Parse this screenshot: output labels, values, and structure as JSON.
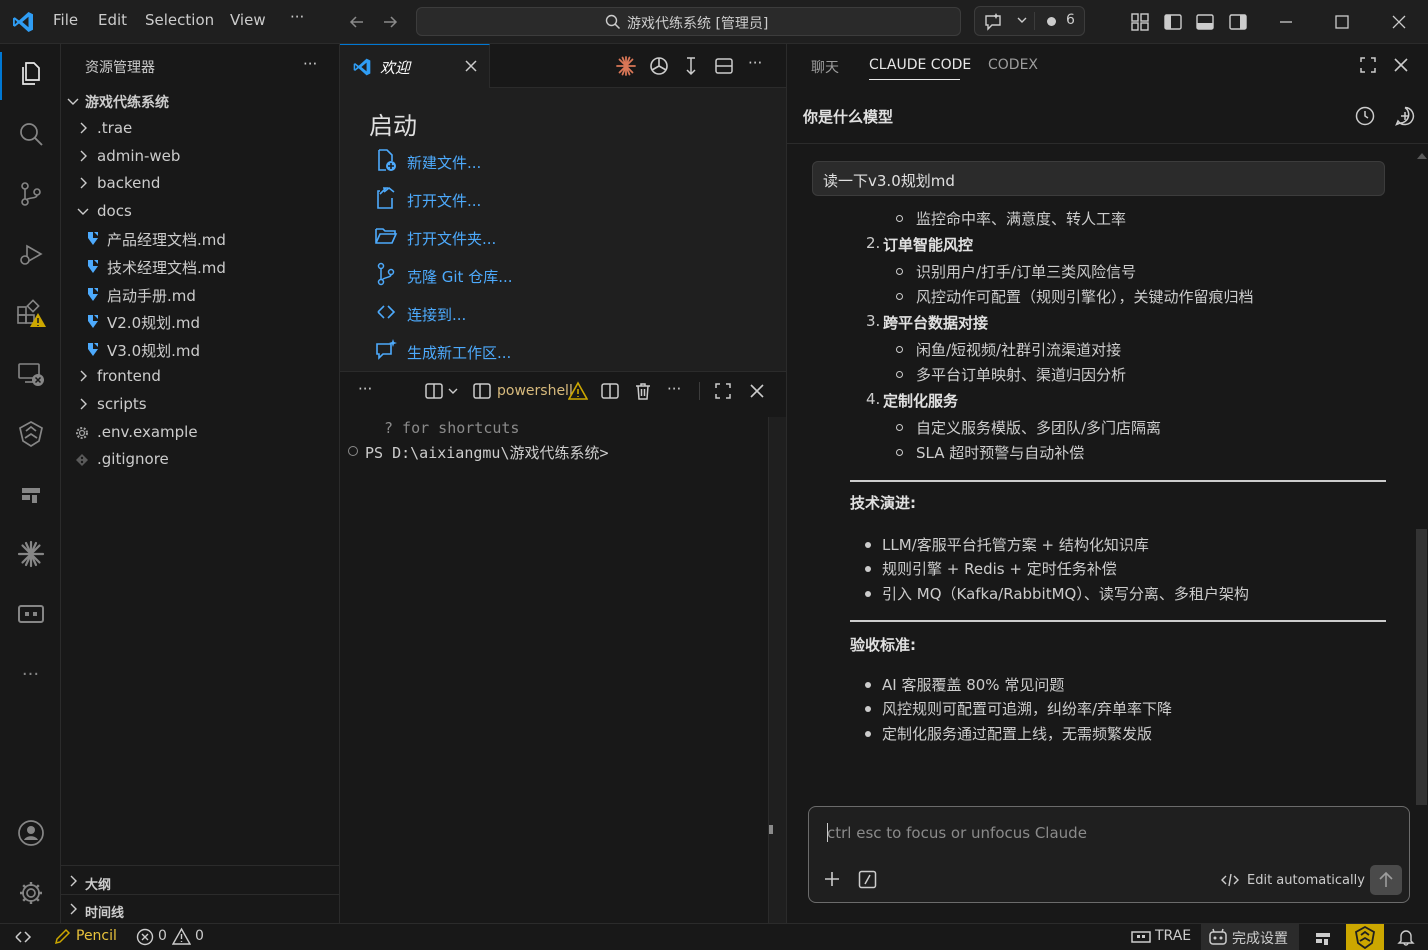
{
  "menu": {
    "file": "File",
    "edit": "Edit",
    "selection": "Selection",
    "view": "View",
    "more": "···"
  },
  "search": {
    "text": "游戏代练系统 [管理员]"
  },
  "chat_pill": {
    "count": "6"
  },
  "sidebar": {
    "title": "资源管理器",
    "more": "···",
    "root": "游戏代练系统",
    "items": [
      {
        "label": ".trae",
        "kind": "folder"
      },
      {
        "label": "admin-web",
        "kind": "folder"
      },
      {
        "label": "backend",
        "kind": "folder"
      },
      {
        "label": "docs",
        "kind": "folder-open"
      },
      {
        "label": "产品经理文档.md",
        "kind": "md"
      },
      {
        "label": "技术经理文档.md",
        "kind": "md"
      },
      {
        "label": "启动手册.md",
        "kind": "md"
      },
      {
        "label": "V2.0规划.md",
        "kind": "md"
      },
      {
        "label": "V3.0规划.md",
        "kind": "md"
      },
      {
        "label": "frontend",
        "kind": "folder"
      },
      {
        "label": "scripts",
        "kind": "folder"
      },
      {
        "label": ".env.example",
        "kind": "gear"
      },
      {
        "label": ".gitignore",
        "kind": "git"
      }
    ],
    "outline": "大纲",
    "timeline": "时间线"
  },
  "editor": {
    "tab_label": "欢迎",
    "start_title": "启动",
    "start_links": [
      "新建文件...",
      "打开文件...",
      "打开文件夹...",
      "克隆 Git 仓库...",
      "连接到...",
      "生成新工作区..."
    ]
  },
  "terminal": {
    "more": "···",
    "shell": "powershell",
    "hint": "? for shortcuts",
    "prompt": "PS D:\\aixiangmu\\游戏代练系统>"
  },
  "panel": {
    "tabs": [
      "聊天",
      "CLAUDE CODE",
      "CODEX"
    ],
    "active_tab": "CLAUDE CODE",
    "conversation_title": "你是什么模型",
    "user_message": "读一下v3.0规划md",
    "content": {
      "item1_sub": "监控命中率、满意度、转人工率",
      "item2_num": "2.",
      "item2_title": "订单智能风控",
      "item2_subs": [
        "识别用户/打手/订单三类风险信号",
        "风控动作可配置（规则引擎化），关键动作留痕归档"
      ],
      "item3_num": "3.",
      "item3_title": "跨平台数据对接",
      "item3_subs": [
        "闲鱼/短视频/社群引流渠道对接",
        "多平台订单映射、渠道归因分析"
      ],
      "item4_num": "4.",
      "item4_title": "定制化服务",
      "item4_subs": [
        "自定义服务模版、多团队/多门店隔离",
        "SLA 超时预警与自动补偿"
      ],
      "tech_heading": "技术演进:",
      "tech_items": [
        "LLM/客服平台托管方案 + 结构化知识库",
        "规则引擎 + Redis + 定时任务补偿",
        "引入 MQ（Kafka/RabbitMQ）、读写分离、多租户架构"
      ],
      "accept_heading": "验收标准:",
      "accept_items": [
        "AI 客服覆盖 80% 常见问题",
        "风控规则可配置可追溯，纠纷率/弃单率下降",
        "定制化服务通过配置上线，无需频繁发版"
      ]
    },
    "input_placeholder": "ctrl esc to focus or unfocus Claude",
    "edit_mode": "Edit automatically"
  },
  "statusbar": {
    "pencil": "Pencil",
    "errors": "0",
    "warnings": "0",
    "trae": "TRAE",
    "settings": "完成设置"
  },
  "colors": {
    "accent": "#0078d4",
    "link": "#4daafc",
    "warning": "#cca700",
    "claude_orange": "#d97757"
  }
}
